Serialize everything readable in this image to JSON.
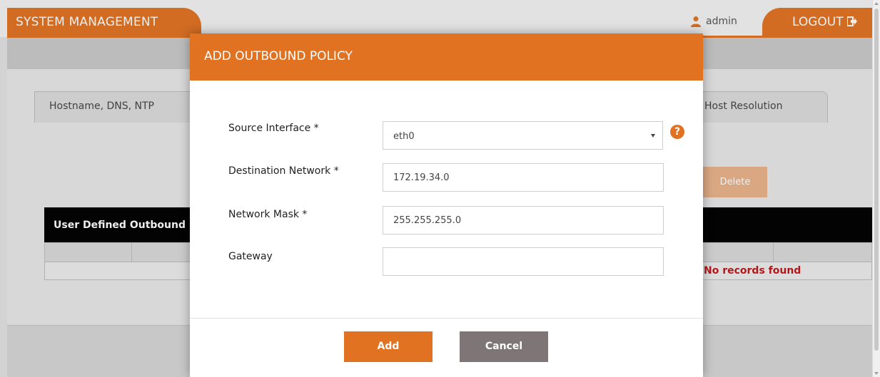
{
  "header": {
    "title": "SYSTEM MANAGEMENT",
    "user": "admin",
    "logout_label": "LOGOUT"
  },
  "tabs": {
    "left": "Hostname, DNS, NTP",
    "right": "Host Resolution"
  },
  "background": {
    "delete_label": "Delete",
    "table_title": "User Defined Outbound",
    "no_records": "No records found"
  },
  "modal": {
    "title": "ADD OUTBOUND POLICY",
    "fields": {
      "source_interface": {
        "label": "Source Interface *",
        "value": "eth0"
      },
      "destination_network": {
        "label": "Destination Network *",
        "value": "172.19.34.0"
      },
      "network_mask": {
        "label": "Network Mask *",
        "value": "255.255.255.0"
      },
      "gateway": {
        "label": "Gateway",
        "value": ""
      }
    },
    "help_glyph": "?",
    "add_label": "Add",
    "cancel_label": "Cancel"
  },
  "colors": {
    "accent": "#e07222",
    "cancel": "#7e7676",
    "error_text": "#c0161a"
  }
}
